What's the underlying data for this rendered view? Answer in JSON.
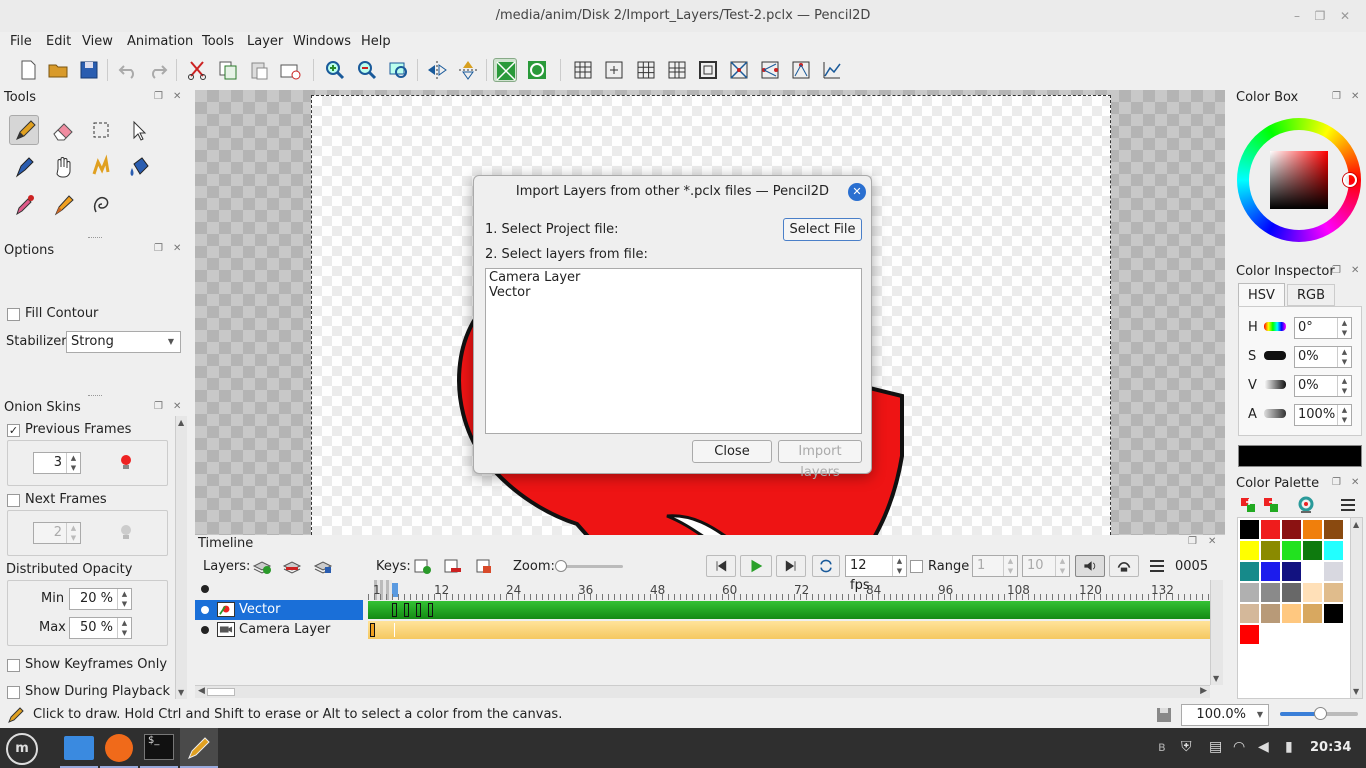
{
  "window": {
    "title": "/media/anim/Disk 2/Import_Layers/Test-2.pclx — Pencil2D"
  },
  "menu": [
    "File",
    "Edit",
    "View",
    "Animation",
    "Tools",
    "Layer",
    "Windows",
    "Help"
  ],
  "panels": {
    "tools": {
      "title": "Tools"
    },
    "options": {
      "title": "Options",
      "fill_contour": "Fill Contour",
      "stabilizer_label": "Stabilizer",
      "stabilizer_value": "Strong"
    },
    "onion": {
      "title": "Onion Skins",
      "previous_frames": "Previous Frames",
      "previous_value": "3",
      "next_frames": "Next Frames",
      "next_value": "2",
      "distributed_opacity": "Distributed Opacity",
      "min_label": "Min",
      "min_value": "20 %",
      "max_label": "Max",
      "max_value": "50 %",
      "show_keyframes_only": "Show Keyframes Only",
      "show_during_playback": "Show During Playback"
    },
    "colorbox": {
      "title": "Color Box"
    },
    "inspector": {
      "title": "Color Inspector",
      "tab_hsv": "HSV",
      "tab_rgb": "RGB",
      "h_label": "H",
      "h_value": "0°",
      "s_label": "S",
      "s_value": "0%",
      "v_label": "V",
      "v_value": "0%",
      "a_label": "A",
      "a_value": "100%",
      "current_color": "#000000"
    },
    "palette": {
      "title": "Color Palette",
      "colors": [
        "#000000",
        "#ef1c1c",
        "#8b1212",
        "#f07f0c",
        "#8a4a10",
        "#ffff00",
        "#8a8a00",
        "#22e21f",
        "#0e7a0e",
        "#22ffff",
        "#168a8a",
        "#1c1ced",
        "#121280",
        "#ffffff",
        "#d8d8e0",
        "#b0b0b0",
        "#8a8a8a",
        "#686868",
        "#ffe0b8",
        "#e0bc8c",
        "#d4b89a",
        "#b89a78",
        "#ffc880",
        "#d8a860",
        "#000000",
        "#ff0000"
      ]
    }
  },
  "dialog": {
    "title": "Import Layers from other *.pclx files — Pencil2D",
    "step1": "1. Select Project file:",
    "select_file": "Select File",
    "step2": "2. Select layers from file:",
    "layers": [
      "Camera Layer",
      "Vector"
    ],
    "close": "Close",
    "import": "Import layers"
  },
  "timeline": {
    "title": "Timeline",
    "layers_label": "Layers:",
    "keys_label": "Keys:",
    "zoom_label": "Zoom:",
    "fps": "12 fps",
    "range_label": "Range",
    "range_start": "1",
    "range_end": "10",
    "frame_counter": "0005",
    "ruler": [
      "1",
      "12",
      "24",
      "36",
      "48",
      "60",
      "72",
      "84",
      "96",
      "108",
      "120",
      "132"
    ],
    "layer_rows": [
      {
        "name": "Vector",
        "selected": true
      },
      {
        "name": "Camera Layer",
        "selected": false
      }
    ]
  },
  "status": {
    "message": "Click to draw. Hold Ctrl and Shift to erase or Alt to select a color from the canvas.",
    "zoom": "100.0%"
  },
  "taskbar": {
    "clock": "20:34"
  }
}
